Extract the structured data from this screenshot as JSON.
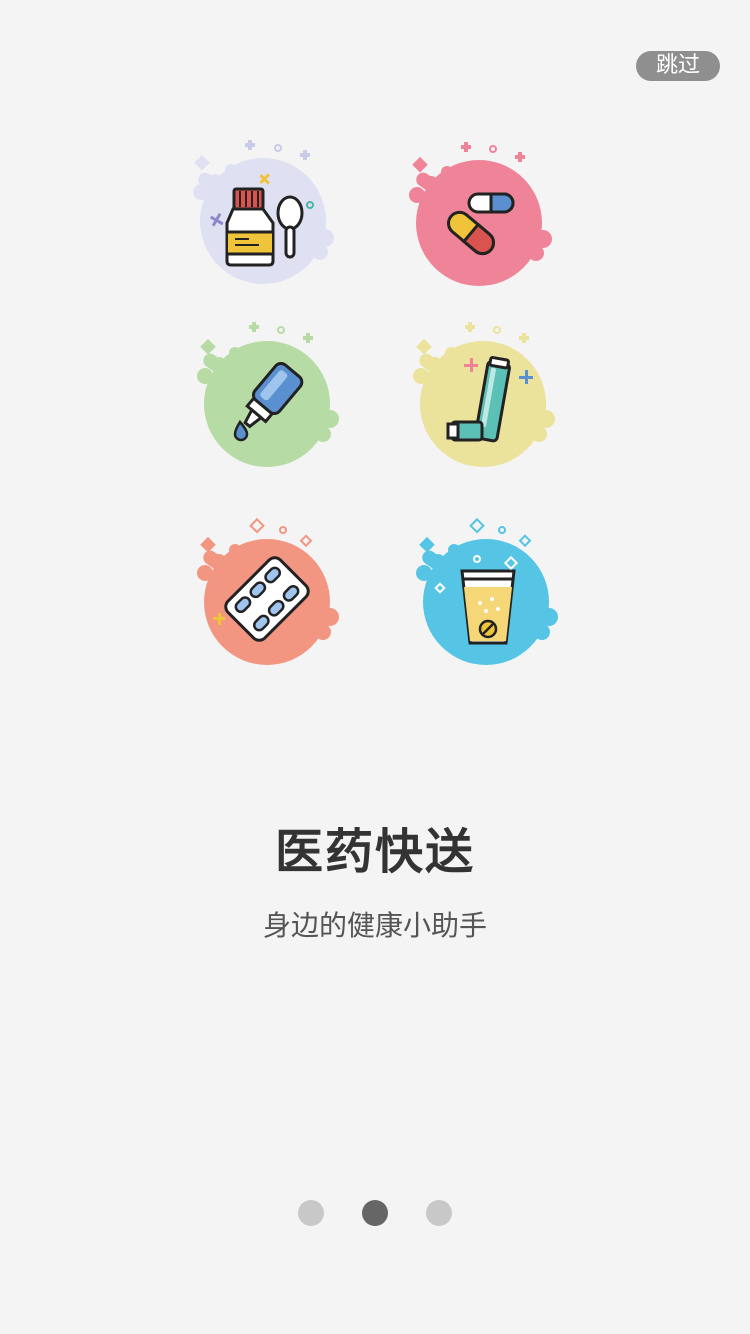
{
  "skip_label": "跳过",
  "tiles": [
    {
      "icon": "syrup-bottle-spoon-icon",
      "bg": "#dfe1f3"
    },
    {
      "icon": "capsules-icon",
      "bg": "#ef8499"
    },
    {
      "icon": "dropper-bottle-icon",
      "bg": "#b7dba4"
    },
    {
      "icon": "inhaler-icon",
      "bg": "#ebe29b"
    },
    {
      "icon": "pill-blister-icon",
      "bg": "#f29682"
    },
    {
      "icon": "effervescent-drink-icon",
      "bg": "#55c4e5"
    }
  ],
  "title": "医药快送",
  "subtitle": "身边的健康小助手",
  "pager": {
    "total": 3,
    "active_index": 1
  },
  "colors": {
    "background": "#f4f4f4",
    "skip_bg": "#8f8f8f",
    "dot_inactive": "#c8c8c8",
    "dot_active": "#666666"
  }
}
